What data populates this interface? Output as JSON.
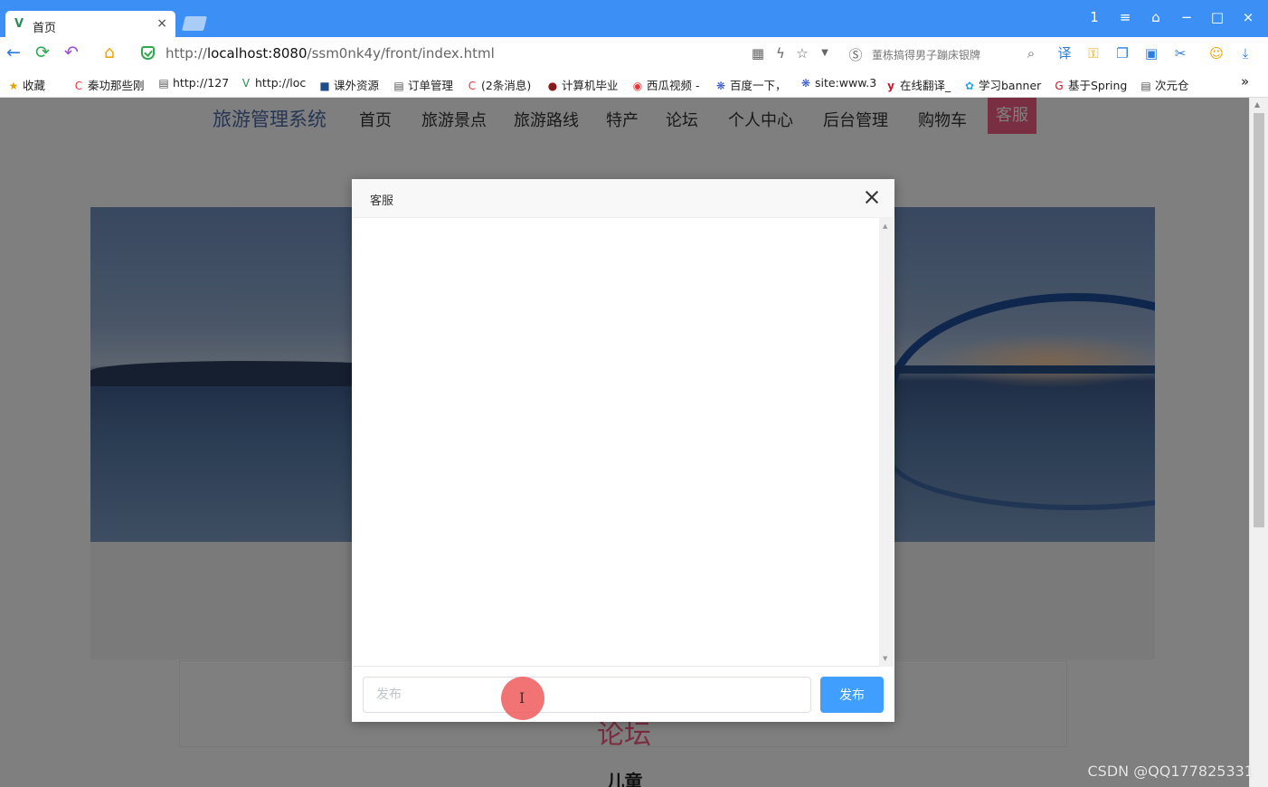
{
  "browser": {
    "tab": {
      "title": "首页",
      "close": "×"
    },
    "window_controls": [
      "1",
      "≡",
      "⌂",
      "−",
      "□",
      "×"
    ],
    "address": {
      "url_prefix": "http://",
      "url_host": "localhost:8080",
      "url_path": "/ssm0nk4y/front/index.html"
    },
    "search_hint": "董栋搞得男子蹦床银牌",
    "bookmarks": [
      {
        "label": "收藏",
        "icon": "star-icon"
      },
      {
        "label": "秦功那些刚",
        "icon": "c-icon"
      },
      {
        "label": "http://127",
        "icon": "page-icon"
      },
      {
        "label": "http://loc",
        "icon": "vue-icon"
      },
      {
        "label": "课外资源",
        "icon": "book-icon"
      },
      {
        "label": "订单管理",
        "icon": "page-icon"
      },
      {
        "label": "(2条消息)",
        "icon": "c-icon"
      },
      {
        "label": "计算机毕业",
        "icon": "circle-icon"
      },
      {
        "label": "西瓜视频 -",
        "icon": "play-icon"
      },
      {
        "label": "百度一下，",
        "icon": "paw-icon"
      },
      {
        "label": "site:www.3",
        "icon": "paw-icon"
      },
      {
        "label": "在线翻译_",
        "icon": "y-icon"
      },
      {
        "label": "学习banner",
        "icon": "globe-icon"
      },
      {
        "label": "基于Spring",
        "icon": "g-icon"
      },
      {
        "label": "次元仓",
        "icon": "page-icon"
      }
    ],
    "bookmarks_more": "»"
  },
  "site": {
    "brand": "旅游管理系统",
    "nav": [
      "首页",
      "旅游景点",
      "旅游路线",
      "特产",
      "论坛",
      "个人中心",
      "后台管理",
      "购物车",
      "客服"
    ],
    "forum_title": "论坛",
    "forum_sub": "儿童"
  },
  "dialog": {
    "title": "客服",
    "input_placeholder": "发布",
    "send_label": "发布"
  },
  "watermark": "CSDN @QQ177825331",
  "colors": {
    "browser_chrome": "#3c8ff5",
    "primary_button": "#409eff",
    "site_accent": "#f35d82"
  }
}
